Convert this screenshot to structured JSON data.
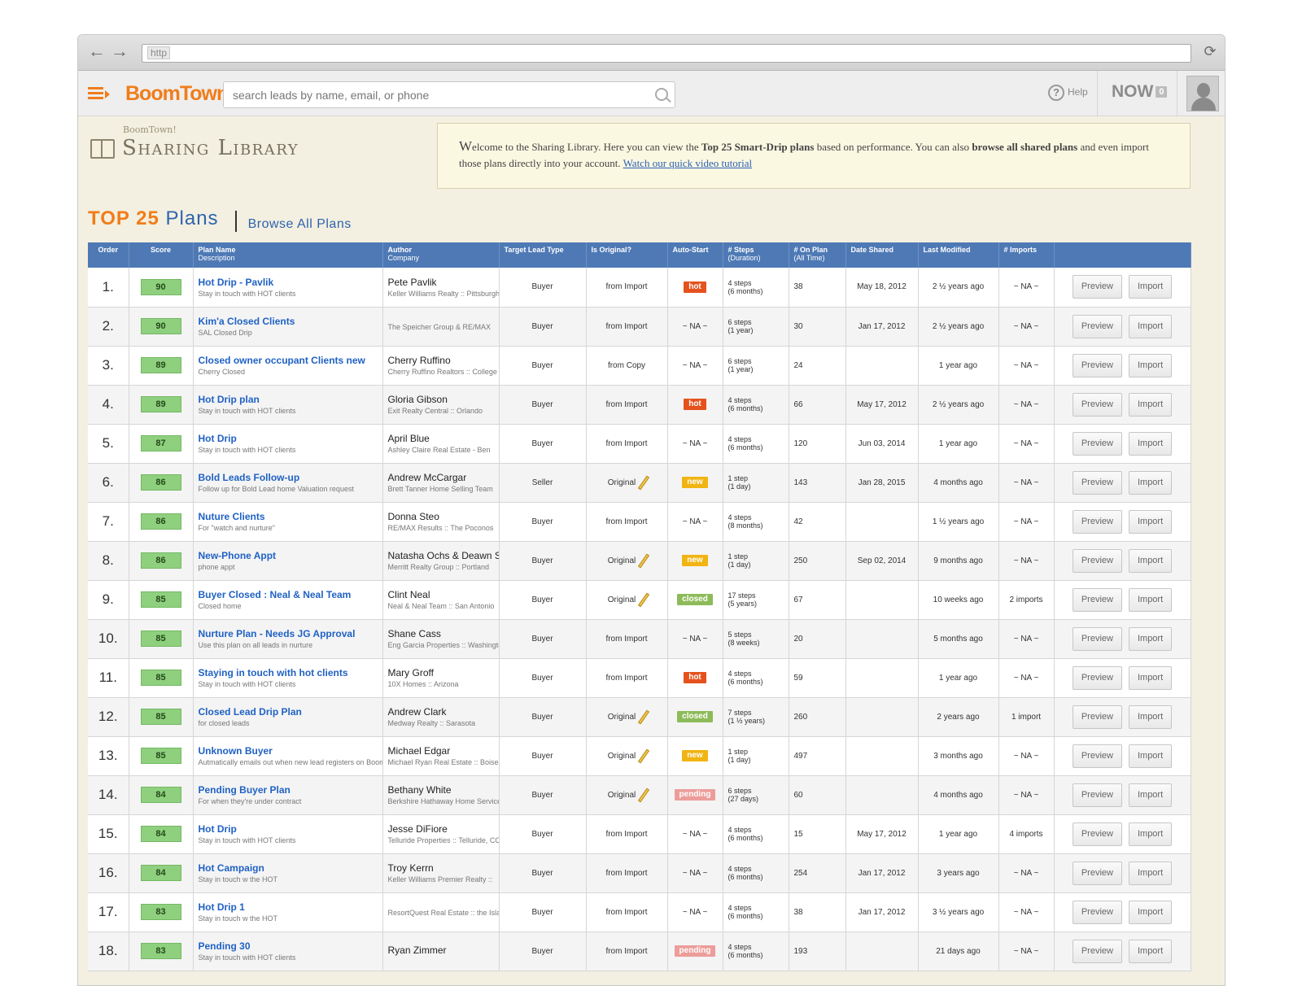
{
  "browser": {
    "url": "http",
    "back_icon": "←",
    "forward_icon": "→",
    "reload_icon": "⟳"
  },
  "appbar": {
    "logo": "BoomTown!",
    "search_placeholder": "search leads by name, email, or phone",
    "help_label": "Help",
    "now_label": "NOW",
    "now_count": "0"
  },
  "library": {
    "small_title": "BoomTown!",
    "title": "Sharing Library",
    "welcome_first": "W",
    "welcome_a": "elcome to the Sharing Library. Here you can view the ",
    "welcome_bold1": "Top 25 Smart-Drip plans",
    "welcome_b": " based on performance. You can also ",
    "welcome_bold2": "browse all shared plans",
    "welcome_c": " and even import those plans directly into your account. ",
    "welcome_link": "Watch our quick video tutorial"
  },
  "tabs": {
    "top25": "TOP 25",
    "plans": "Plans",
    "browse": "Browse All Plans"
  },
  "table": {
    "headers": {
      "order": "Order",
      "score": "Score",
      "plan_name": "Plan Name",
      "description": "Description",
      "author": "Author",
      "company": "Company",
      "target": "Target Lead Type",
      "original": "Is Original?",
      "autostart": "Auto-Start",
      "steps": "# Steps",
      "duration": "(Duration)",
      "onplan": "# On Plan",
      "alltime": "(All Time)",
      "shared": "Date Shared",
      "modified": "Last Modified",
      "imports": "# Imports"
    },
    "preview_label": "Preview",
    "import_label": "Import",
    "rows": [
      {
        "order": "1.",
        "score": "90",
        "name": "Hot Drip - Pavlik",
        "desc": "Stay in touch with HOT clients",
        "author": "Pete Pavlik",
        "company": "Keller Williams Realty :: Pittsburgh",
        "target": "Buyer",
        "original": "from Import",
        "pencil": false,
        "auto": "hot",
        "steps": "4 steps",
        "duration": "(6 months)",
        "onplan": "38",
        "shared": "May 18, 2012",
        "modified": "2 ½ years ago",
        "imports": "~ NA ~"
      },
      {
        "order": "2.",
        "score": "90",
        "name": "Kim'a Closed Clients",
        "desc": "SAL Closed Drip",
        "author": "",
        "company": "The Speicher Group & RE/MAX",
        "target": "Buyer",
        "original": "from Import",
        "pencil": false,
        "auto": "~ NA ~",
        "steps": "6 steps",
        "duration": "(1 year)",
        "onplan": "30",
        "shared": "Jan 17, 2012",
        "modified": "2 ½ years ago",
        "imports": "~ NA ~"
      },
      {
        "order": "3.",
        "score": "89",
        "name": "Closed owner occupant Clients new",
        "desc": "Cherry Closed",
        "author": "Cherry Ruffino",
        "company": "Cherry Ruffino Realtors :: College",
        "target": "Buyer",
        "original": "from Copy",
        "pencil": false,
        "auto": "~ NA ~",
        "steps": "6 steps",
        "duration": "(1 year)",
        "onplan": "24",
        "shared": "",
        "modified": "1 year ago",
        "imports": "~ NA ~"
      },
      {
        "order": "4.",
        "score": "89",
        "name": "Hot Drip plan",
        "desc": "Stay in touch with HOT clients",
        "author": "Gloria Gibson",
        "company": "Exit Realty Central :: Orlando",
        "target": "Buyer",
        "original": "from Import",
        "pencil": false,
        "auto": "hot",
        "steps": "4 steps",
        "duration": "(6 months)",
        "onplan": "66",
        "shared": "May 17, 2012",
        "modified": "2 ½ years ago",
        "imports": "~ NA ~"
      },
      {
        "order": "5.",
        "score": "87",
        "name": "Hot Drip",
        "desc": "Stay in touch with HOT clients",
        "author": "April Blue",
        "company": "Ashley Claire Real Estate - Ben",
        "target": "Buyer",
        "original": "from Import",
        "pencil": false,
        "auto": "~ NA ~",
        "steps": "4 steps",
        "duration": "(6 months)",
        "onplan": "120",
        "shared": "Jun 03, 2014",
        "modified": "1 year ago",
        "imports": "~ NA ~"
      },
      {
        "order": "6.",
        "score": "86",
        "name": "Bold Leads Follow-up",
        "desc": "Follow up for Bold Lead home Valuation request",
        "author": "Andrew McCargar",
        "company": "Brett Tanner Home Selling Team",
        "target": "Seller",
        "original": "Original",
        "pencil": true,
        "auto": "new",
        "steps": "1 step",
        "duration": "(1 day)",
        "onplan": "143",
        "shared": "Jan 28, 2015",
        "modified": "4 months ago",
        "imports": "~ NA ~"
      },
      {
        "order": "7.",
        "score": "86",
        "name": "Nuture Clients",
        "desc": "For \"watch and nurture\"",
        "author": "Donna Steo",
        "company": "RE/MAX Results :: The Poconos",
        "target": "Buyer",
        "original": "from Import",
        "pencil": false,
        "auto": "~ NA ~",
        "steps": "4 steps",
        "duration": "(8 months)",
        "onplan": "42",
        "shared": "",
        "modified": "1 ½ years ago",
        "imports": "~ NA ~"
      },
      {
        "order": "8.",
        "score": "86",
        "name": "New-Phone Appt",
        "desc": "phone appt",
        "author": "Natasha Ochs & Deawn Smith",
        "company": "Merritt Realty Group :: Portland",
        "target": "Buyer",
        "original": "Original",
        "pencil": true,
        "auto": "new",
        "steps": "1 step",
        "duration": "(1 day)",
        "onplan": "250",
        "shared": "Sep 02, 2014",
        "modified": "9 months ago",
        "imports": "~ NA ~"
      },
      {
        "order": "9.",
        "score": "85",
        "name": "Buyer Closed : Neal & Neal Team",
        "desc": "Closed home",
        "author": "Clint Neal",
        "company": "Neal & Neal Team :: San Antonio",
        "target": "Buyer",
        "original": "Original",
        "pencil": true,
        "auto": "closed",
        "steps": "17 steps",
        "duration": "(5 years)",
        "onplan": "67",
        "shared": "",
        "modified": "10 weeks ago",
        "imports": "2 imports"
      },
      {
        "order": "10.",
        "score": "85",
        "name": "Nurture Plan - Needs JG Approval",
        "desc": "Use this plan on all leads in nurture",
        "author": "Shane Cass",
        "company": "Eng Garcia Properties :: Washington",
        "target": "Buyer",
        "original": "from Import",
        "pencil": false,
        "auto": "~ NA ~",
        "steps": "5 steps",
        "duration": "(8 weeks)",
        "onplan": "20",
        "shared": "",
        "modified": "5 months ago",
        "imports": "~ NA ~"
      },
      {
        "order": "11.",
        "score": "85",
        "name": "Staying in touch with hot clients",
        "desc": "Stay in touch with HOT clients",
        "author": "Mary Groff",
        "company": "10X Homes :: Arizona",
        "target": "Buyer",
        "original": "from Import",
        "pencil": false,
        "auto": "hot",
        "steps": "4 steps",
        "duration": "(6 months)",
        "onplan": "59",
        "shared": "",
        "modified": "1 year ago",
        "imports": "~ NA ~"
      },
      {
        "order": "12.",
        "score": "85",
        "name": "Closed Lead Drip Plan",
        "desc": "for closed leads",
        "author": "Andrew Clark",
        "company": "Medway Realty :: Sarasota",
        "target": "Buyer",
        "original": "Original",
        "pencil": true,
        "auto": "closed",
        "steps": "7 steps",
        "duration": "(1 ½ years)",
        "onplan": "260",
        "shared": "",
        "modified": "2 years ago",
        "imports": "1 import"
      },
      {
        "order": "13.",
        "score": "85",
        "name": "Unknown Buyer",
        "desc": "Autmatically emails out when new lead registers on BoomTown",
        "author": "Michael Edgar",
        "company": "Michael Ryan Real Estate :: Boise",
        "target": "Buyer",
        "original": "Original",
        "pencil": true,
        "auto": "new",
        "steps": "1 step",
        "duration": "(1 day)",
        "onplan": "497",
        "shared": "",
        "modified": "3 months ago",
        "imports": "~ NA ~"
      },
      {
        "order": "14.",
        "score": "84",
        "name": "Pending Buyer Plan",
        "desc": "For when they're under contract",
        "author": "Bethany White",
        "company": "Berkshire Hathaway Home Services",
        "target": "Buyer",
        "original": "Original",
        "pencil": true,
        "auto": "pending",
        "steps": "6 steps",
        "duration": "(27 days)",
        "onplan": "60",
        "shared": "",
        "modified": "4 months ago",
        "imports": "~ NA ~"
      },
      {
        "order": "15.",
        "score": "84",
        "name": "Hot Drip",
        "desc": "Stay in touch with HOT clients",
        "author": "Jesse DiFiore",
        "company": "Telluride Properties :: Telluride, CO",
        "target": "Buyer",
        "original": "from Import",
        "pencil": false,
        "auto": "~ NA ~",
        "steps": "4 steps",
        "duration": "(6 months)",
        "onplan": "15",
        "shared": "May 17, 2012",
        "modified": "1 year ago",
        "imports": "4 imports"
      },
      {
        "order": "16.",
        "score": "84",
        "name": "Hot Campaign",
        "desc": "Stay in touch w the HOT",
        "author": "Troy Kerrn",
        "company": "Keller Williams Premier Realty :: ",
        "target": "Buyer",
        "original": "from Import",
        "pencil": false,
        "auto": "~ NA ~",
        "steps": "4 steps",
        "duration": "(6 months)",
        "onplan": "254",
        "shared": "Jan 17, 2012",
        "modified": "3 years ago",
        "imports": "~ NA ~"
      },
      {
        "order": "17.",
        "score": "83",
        "name": "Hot Drip 1",
        "desc": "Stay in touch w the HOT",
        "author": "",
        "company": "ResortQuest Real Estate :: the Islands",
        "target": "Buyer",
        "original": "from Import",
        "pencil": false,
        "auto": "~ NA ~",
        "steps": "4 steps",
        "duration": "(6 months)",
        "onplan": "38",
        "shared": "Jan 17, 2012",
        "modified": "3 ½ years ago",
        "imports": "~ NA ~"
      },
      {
        "order": "18.",
        "score": "83",
        "name": "Pending 30",
        "desc": "Stay in touch with HOT clients",
        "author": "Ryan Zimmer",
        "company": "",
        "target": "Buyer",
        "original": "from Import",
        "pencil": false,
        "auto": "pending",
        "steps": "4 steps",
        "duration": "(6 months)",
        "onplan": "193",
        "shared": "",
        "modified": "21 days ago",
        "imports": "~ NA ~"
      }
    ]
  }
}
